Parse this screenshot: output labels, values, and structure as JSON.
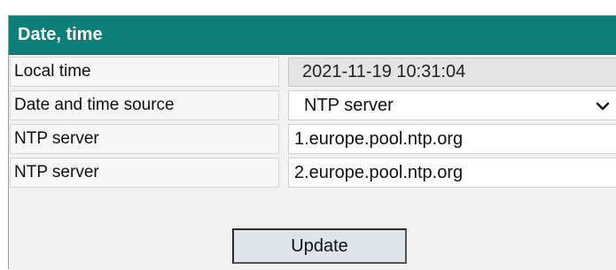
{
  "panel": {
    "title": "Date, time",
    "accent_color": "#0e7f78"
  },
  "rows": [
    {
      "label": "Local time",
      "value": "2021-11-19 10:31:04",
      "kind": "readonly"
    },
    {
      "label": "Date and time source",
      "value": "NTP server",
      "kind": "select",
      "icon": "chevron-down-icon"
    },
    {
      "label": "NTP server",
      "value": "1.europe.pool.ntp.org",
      "kind": "text"
    },
    {
      "label": "NTP server",
      "value": "2.europe.pool.ntp.org",
      "kind": "text"
    }
  ],
  "actions": {
    "update_label": "Update"
  }
}
